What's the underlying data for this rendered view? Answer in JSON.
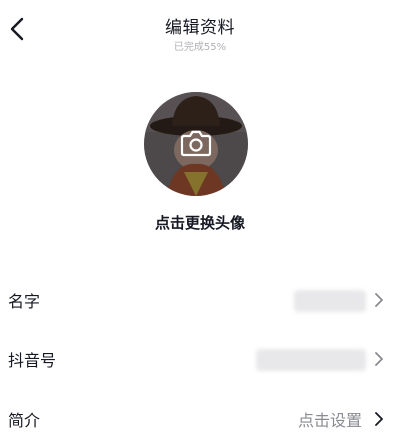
{
  "header": {
    "title": "编辑资料",
    "subtitle": "已完成55%",
    "back_icon": "chevron-left-icon"
  },
  "avatar": {
    "change_label": "点击更换头像",
    "camera_icon": "camera-icon"
  },
  "fields": [
    {
      "label": "名字",
      "value": ""
    },
    {
      "label": "抖音号",
      "value": ""
    },
    {
      "label": "简介",
      "value": "点击设置"
    }
  ],
  "colors": {
    "text_primary": "#161823",
    "text_secondary": "#8a8b91",
    "subtitle": "#b0b0b6"
  }
}
